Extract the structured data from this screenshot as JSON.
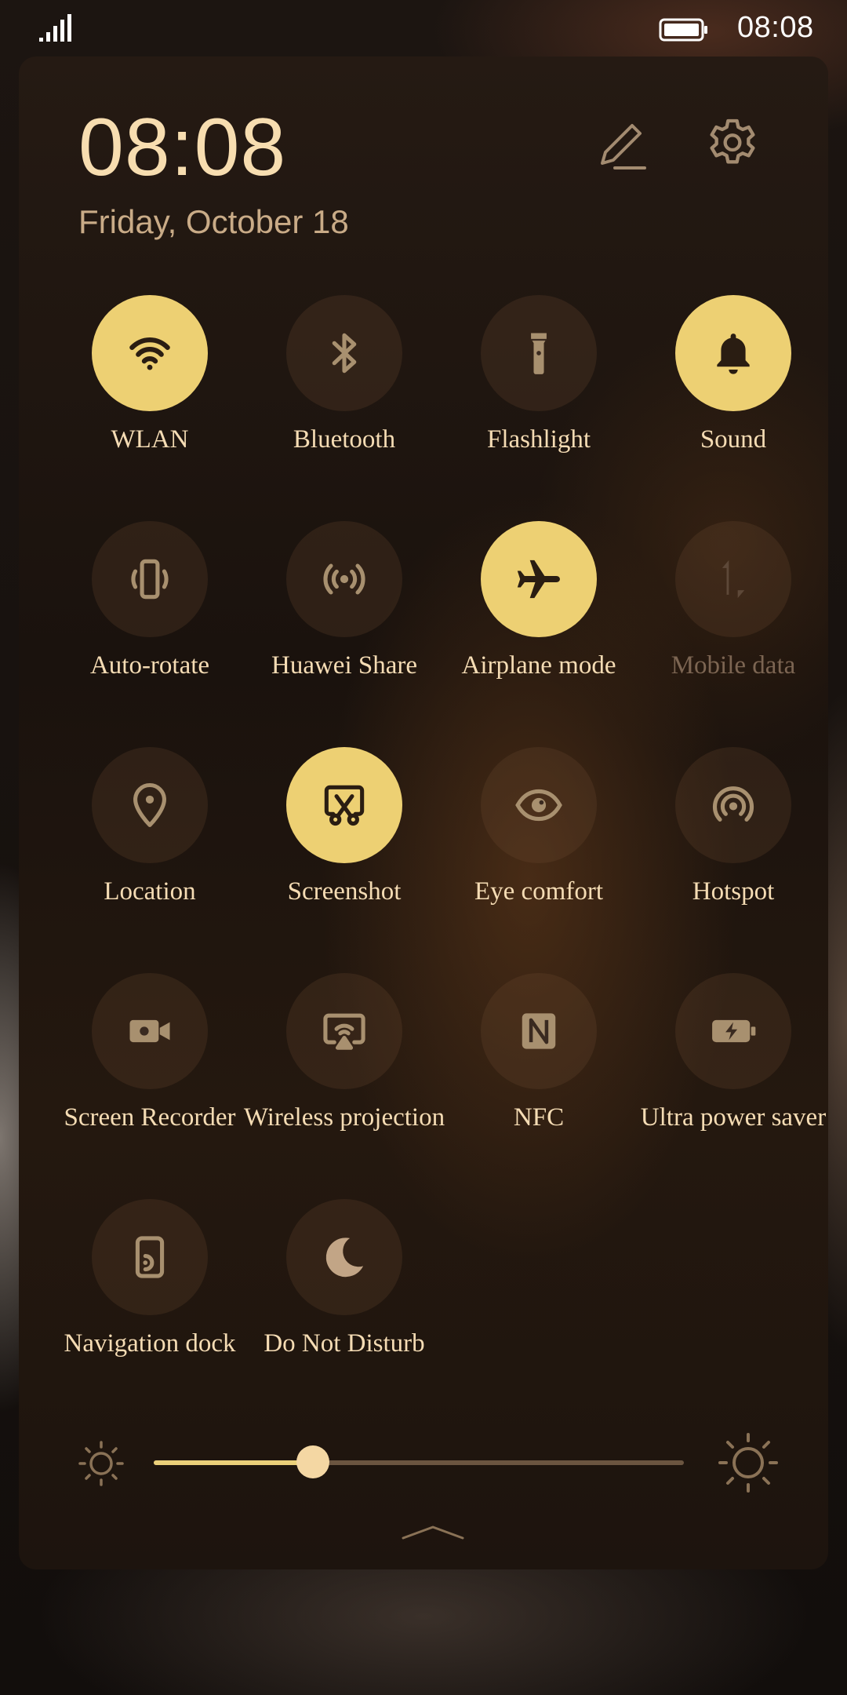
{
  "status_bar": {
    "time": "08:08",
    "signal_icon": "signal-icon",
    "battery_icon": "battery-icon"
  },
  "header": {
    "time": "08:08",
    "date": "Friday,  October  18",
    "edit_icon": "pencil-icon",
    "settings_icon": "gear-icon"
  },
  "colors": {
    "active": "#edd073",
    "inactive": "#3a2a20",
    "text": "#f5dcb4",
    "date": "#c9ab87",
    "disabled_text": "#7c6552"
  },
  "tiles": [
    {
      "label": "WLAN",
      "icon": "wifi-icon",
      "active": true
    },
    {
      "label": "Bluetooth",
      "icon": "bluetooth-icon",
      "active": false
    },
    {
      "label": "Flashlight",
      "icon": "flashlight-icon",
      "active": false
    },
    {
      "label": "Sound",
      "icon": "bell-icon",
      "active": true
    },
    {
      "label": "Auto-rotate",
      "icon": "auto-rotate-icon",
      "active": false
    },
    {
      "label": "Huawei Share",
      "icon": "huawei-share-icon",
      "active": false
    },
    {
      "label": "Airplane mode",
      "icon": "airplane-icon",
      "active": true
    },
    {
      "label": "Mobile data",
      "icon": "mobile-data-icon",
      "active": false,
      "disabled": true
    },
    {
      "label": "Location",
      "icon": "location-pin-icon",
      "active": false
    },
    {
      "label": "Screenshot",
      "icon": "screenshot-icon",
      "active": true
    },
    {
      "label": "Eye comfort",
      "icon": "eye-icon",
      "active": false
    },
    {
      "label": "Hotspot",
      "icon": "hotspot-icon",
      "active": false
    },
    {
      "label": "Screen Recorder",
      "icon": "video-camera-icon",
      "active": false
    },
    {
      "label": "Wireless projection",
      "icon": "wireless-projection-icon",
      "active": false
    },
    {
      "label": "NFC",
      "icon": "nfc-icon",
      "active": false
    },
    {
      "label": "Ultra power saver",
      "icon": "battery-bolt-icon",
      "active": false
    },
    {
      "label": "Navigation dock",
      "icon": "navigation-dock-icon",
      "active": false
    },
    {
      "label": "Do Not Disturb",
      "icon": "moon-icon",
      "active": false
    }
  ],
  "brightness": {
    "level_percent": 30,
    "low_icon": "brightness-low-icon",
    "high_icon": "brightness-high-icon"
  },
  "collapse_icon": "chevron-up-icon"
}
